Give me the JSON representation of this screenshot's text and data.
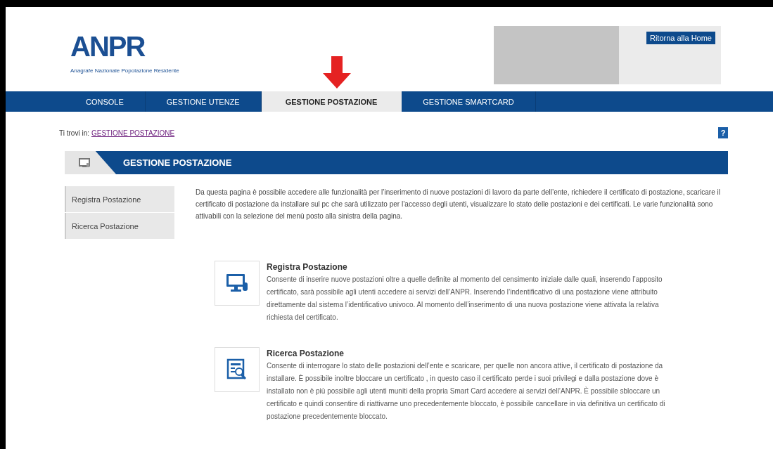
{
  "header": {
    "logo_text": "ANPR",
    "logo_subtitle": "Anagrafe Nazionale Popolazione Residente",
    "home_button": "Ritorna alla Home"
  },
  "tabs": [
    {
      "label": "CONSOLE",
      "selected": false
    },
    {
      "label": "GESTIONE UTENZE",
      "selected": false
    },
    {
      "label": "GESTIONE POSTAZIONE",
      "selected": true
    },
    {
      "label": "GESTIONE SMARTCARD",
      "selected": false
    }
  ],
  "breadcrumb": {
    "prefix": "Ti trovi in:",
    "link": "GESTIONE POSTAZIONE"
  },
  "help_button": "?",
  "section_title": "GESTIONE POSTAZIONE",
  "sidebar": {
    "items": [
      {
        "label": "Registra Postazione",
        "selected": false
      },
      {
        "label": "Ricerca Postazione",
        "selected": false
      }
    ]
  },
  "intro": "Da questa pagina è possibile accedere alle funzionalità per l’inserimento di nuove postazioni di lavoro da parte dell’ente, richiedere il certificato di postazione, scaricare il certificato di postazione da installare sul pc che sarà utilizzato per l’accesso degli utenti, visualizzare lo stato delle postazioni e dei certificati. Le varie funzionalità sono attivabili con la selezione del menù posto alla sinistra della pagina.",
  "features": [
    {
      "kind": "monitor",
      "title": "Registra Postazione",
      "text": "Consente di inserire nuove postazioni oltre a quelle definite al momento del censimento iniziale dalle quali, inserendo l’apposito certificato, sarà possibile agli utenti accedere ai servizi dell’ANPR. Inserendo l’indentificativo di una postazione viene attribuito direttamente dal sistema l’identificativo univoco. Al momento dell’inserimento di una nuova postazione viene attivata la relativa richiesta del certificato."
    },
    {
      "kind": "search",
      "title": "Ricerca Postazione",
      "text": "Consente di interrogare lo stato delle postazioni dell’ente e scaricare, per quelle non ancora attive, il certificato di postazione da installare. È possibile inoltre bloccare un certificato , in questo caso il certificato perde i suoi privilegi e dalla postazione dove è installato non è più possibile agli utenti muniti della propria Smart Card accedere ai servizi dell’ANPR. È possibile sbloccare un certificato e quindi consentire di riattivarne uno precedentemente bloccato, è possibile cancellare in via definitiva un certificato di postazione precedentemente bloccato."
    }
  ]
}
